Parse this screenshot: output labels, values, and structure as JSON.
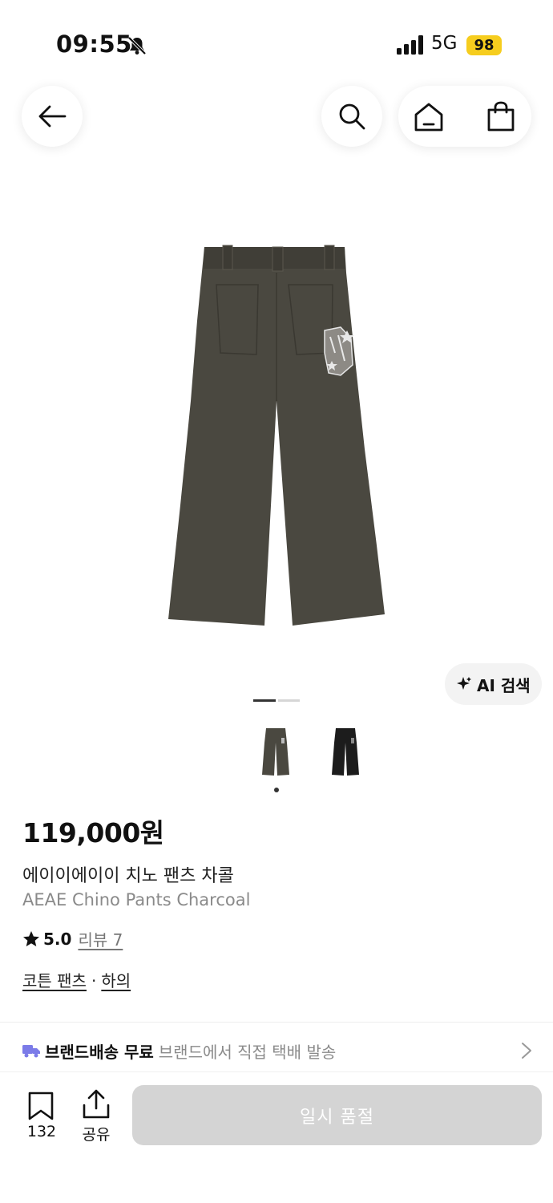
{
  "status_bar": {
    "time": "09:55",
    "network": "5G",
    "battery": "98"
  },
  "product": {
    "price": "119,000원",
    "name_ko": "에이이에이이 치노 팬츠 차콜",
    "name_en": "AEAE Chino Pants Charcoal",
    "rating": "5.0",
    "review_label": "리뷰 7",
    "categories": [
      "코튼 팬츠",
      "하의"
    ],
    "category_separator": "·",
    "image_colors": [
      "#4a4840",
      "#1c1c1c"
    ]
  },
  "gallery": {
    "ai_search_label": "AI 검색"
  },
  "delivery": {
    "title": "브랜드배송 무료",
    "description": "브랜드에서 직접 택배 발송",
    "icon_color": "#7b7be8"
  },
  "bottom_bar": {
    "bookmark_count": "132",
    "share_label": "공유",
    "soldout_label": "일시 품절"
  },
  "icons": [
    "bell-off-icon",
    "signal-icon",
    "back-arrow-icon",
    "search-icon",
    "home-icon",
    "shopping-bag-icon",
    "sparkle-icon",
    "star-icon",
    "truck-icon",
    "chevron-right-icon",
    "bookmark-icon",
    "share-icon"
  ]
}
